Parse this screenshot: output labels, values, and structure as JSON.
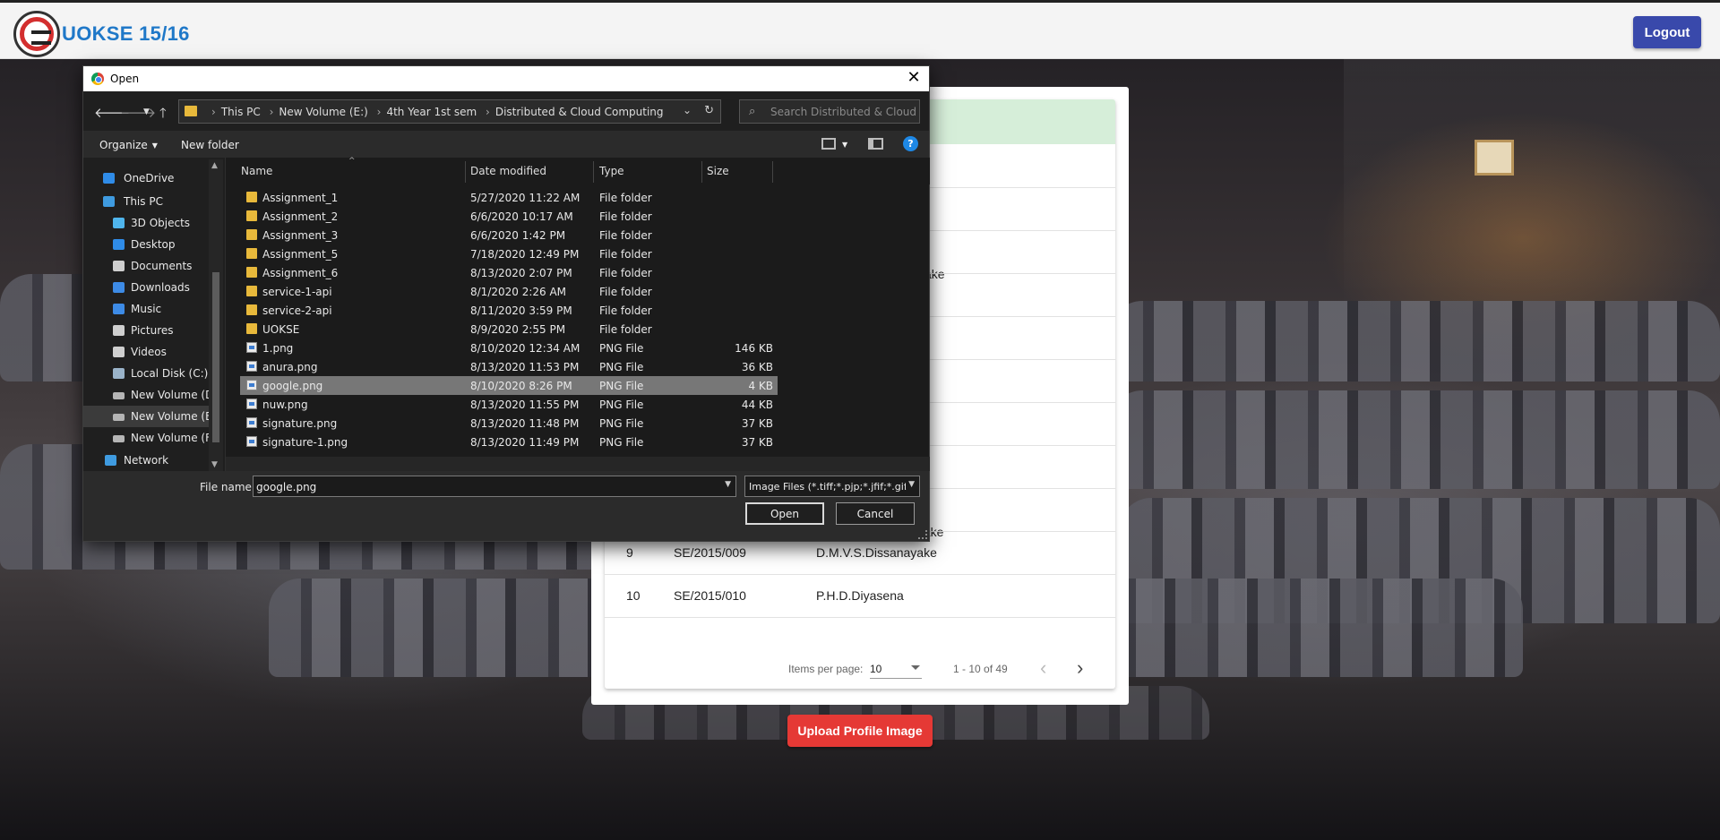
{
  "header": {
    "app_title": "UOKSE 15/16",
    "logout_label": "Logout"
  },
  "table": {
    "partial_rows": [
      "ake",
      "ayake"
    ],
    "rows": [
      {
        "no": "9",
        "index": "SE/2015/009",
        "name": "D.M.V.S.Dissanayake"
      },
      {
        "no": "10",
        "index": "SE/2015/010",
        "name": "P.H.D.Diyasena"
      }
    ],
    "paginator": {
      "items_per_page_label": "Items per page:",
      "page_size": "10",
      "range_label": "1 - 10 of 49",
      "prev_icon": "chevron-left-icon",
      "next_icon": "chevron-right-icon"
    }
  },
  "upload_label": "Upload Profile Image",
  "dialog": {
    "title": "Open",
    "close_glyph": "✕",
    "breadcrumbs": [
      "This PC",
      "New Volume (E:)",
      "4th Year 1st sem",
      "Distributed & Cloud Computing"
    ],
    "search_placeholder": "Search Distributed & Cloud ...",
    "organize_label": "Organize",
    "new_folder_label": "New folder",
    "help_glyph": "?",
    "sidebar": [
      {
        "label": "OneDrive",
        "icon": "cloud-icon",
        "color": "#2f8ce8"
      },
      {
        "label": "This PC",
        "icon": "computer-icon",
        "color": "#3f9be0"
      },
      {
        "label": "3D Objects",
        "icon": "cube-icon",
        "color": "#4fb5ec"
      },
      {
        "label": "Desktop",
        "icon": "desktop-icon",
        "color": "#2f8ce8"
      },
      {
        "label": "Documents",
        "icon": "documents-icon",
        "color": "#cfcfcf"
      },
      {
        "label": "Downloads",
        "icon": "download-icon",
        "color": "#3d8be6"
      },
      {
        "label": "Music",
        "icon": "music-icon",
        "color": "#3d8be6"
      },
      {
        "label": "Pictures",
        "icon": "pictures-icon",
        "color": "#cfcfcf"
      },
      {
        "label": "Videos",
        "icon": "videos-icon",
        "color": "#cfcfcf"
      },
      {
        "label": "Local Disk (C:)",
        "icon": "disk-icon",
        "color": "#9ab3c9"
      },
      {
        "label": "New Volume (D:",
        "icon": "drive-icon",
        "color": "#b5b5b5"
      },
      {
        "label": "New Volume (E:)",
        "icon": "drive-icon",
        "color": "#b5b5b5"
      },
      {
        "label": "New Volume (F:)",
        "icon": "drive-icon",
        "color": "#b5b5b5"
      },
      {
        "label": "Network",
        "icon": "network-icon",
        "color": "#3f9be0"
      }
    ],
    "columns": {
      "name": "Name",
      "date": "Date modified",
      "type": "Type",
      "size": "Size"
    },
    "files": [
      {
        "name": "Assignment_1",
        "date": "5/27/2020 11:22 AM",
        "type": "File folder",
        "size": "",
        "kind": "folder"
      },
      {
        "name": "Assignment_2",
        "date": "6/6/2020 10:17 AM",
        "type": "File folder",
        "size": "",
        "kind": "folder"
      },
      {
        "name": "Assignment_3",
        "date": "6/6/2020 1:42 PM",
        "type": "File folder",
        "size": "",
        "kind": "folder"
      },
      {
        "name": "Assignment_5",
        "date": "7/18/2020 12:49 PM",
        "type": "File folder",
        "size": "",
        "kind": "folder"
      },
      {
        "name": "Assignment_6",
        "date": "8/13/2020 2:07 PM",
        "type": "File folder",
        "size": "",
        "kind": "folder"
      },
      {
        "name": "service-1-api",
        "date": "8/1/2020 2:26 AM",
        "type": "File folder",
        "size": "",
        "kind": "folder"
      },
      {
        "name": "service-2-api",
        "date": "8/11/2020 3:59 PM",
        "type": "File folder",
        "size": "",
        "kind": "folder"
      },
      {
        "name": "UOKSE",
        "date": "8/9/2020 2:55 PM",
        "type": "File folder",
        "size": "",
        "kind": "folder"
      },
      {
        "name": "1.png",
        "date": "8/10/2020 12:34 AM",
        "type": "PNG File",
        "size": "146 KB",
        "kind": "png"
      },
      {
        "name": "anura.png",
        "date": "8/13/2020 11:53 PM",
        "type": "PNG File",
        "size": "36 KB",
        "kind": "png"
      },
      {
        "name": "google.png",
        "date": "8/10/2020 8:26 PM",
        "type": "PNG File",
        "size": "4 KB",
        "kind": "png",
        "selected": true
      },
      {
        "name": "nuw.png",
        "date": "8/13/2020 11:55 PM",
        "type": "PNG File",
        "size": "44 KB",
        "kind": "png"
      },
      {
        "name": "signature.png",
        "date": "8/13/2020 11:48 PM",
        "type": "PNG File",
        "size": "37 KB",
        "kind": "png"
      },
      {
        "name": "signature-1.png",
        "date": "8/13/2020 11:49 PM",
        "type": "PNG File",
        "size": "37 KB",
        "kind": "png"
      }
    ],
    "file_name_label": "File name:",
    "file_name_value": "google.png",
    "file_type_value": "Image Files (*.tiff;*.pjp;*.jfif;*.gif",
    "open_label": "Open",
    "cancel_label": "Cancel"
  }
}
